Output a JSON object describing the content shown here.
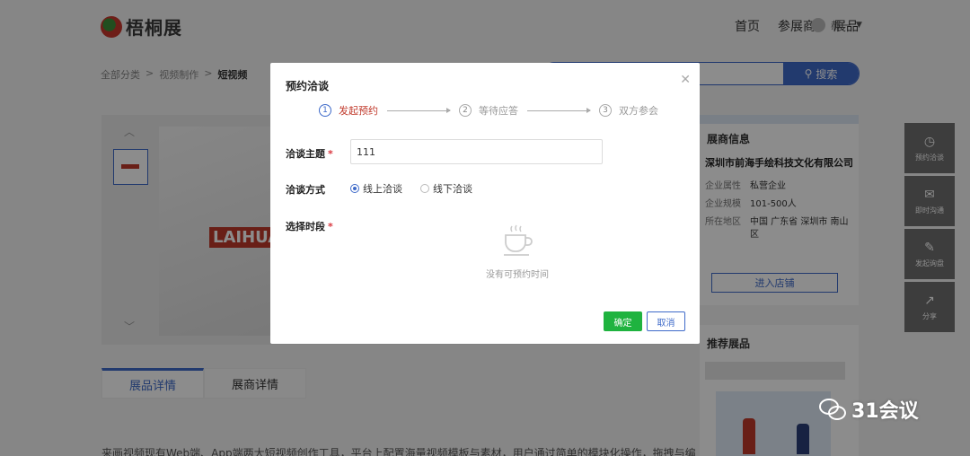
{
  "header": {
    "logo_text": "梧桐展",
    "nav": [
      "首页",
      "参展商",
      "展品"
    ],
    "user_name": "郝一"
  },
  "breadcrumb": {
    "items": [
      "全部分类",
      "视频制作"
    ],
    "current": "短视频",
    "separator": ">"
  },
  "search": {
    "button_label": "搜索"
  },
  "gallery": {
    "brand_text": "LAIHUA"
  },
  "detail_tabs": [
    "展品详情",
    "展商详情"
  ],
  "description": "来画视频现有Web端、App端两大短视频创作工具，平台上配置海量视频模板与素材，用户通过简单的模块化操作，拖拽与编",
  "exhibitor": {
    "title": "展商信息",
    "company": "深圳市前海手绘科技文化有限公司",
    "fields": [
      {
        "key": "企业属性",
        "value": "私营企业"
      },
      {
        "key": "企业规模",
        "value": "101-500人"
      },
      {
        "key": "所在地区",
        "value": "中国 广东省 深圳市 南山区"
      }
    ],
    "enter_button": "进入店铺"
  },
  "recommend": {
    "title": "推荐展品"
  },
  "side_tools": [
    {
      "icon": "clock-icon",
      "label": "预约洽谈"
    },
    {
      "icon": "chat-icon",
      "label": "即时沟通"
    },
    {
      "icon": "inquiry-icon",
      "label": "发起询盘"
    },
    {
      "icon": "share-icon",
      "label": "分享"
    }
  ],
  "watermark": "31会议",
  "modal": {
    "title": "预约洽谈",
    "steps": [
      {
        "num": "1",
        "label": "发起预约"
      },
      {
        "num": "2",
        "label": "等待应答"
      },
      {
        "num": "3",
        "label": "双方参会"
      }
    ],
    "topic_label": "洽谈主题",
    "topic_value": "111",
    "method_label": "洽谈方式",
    "methods": [
      "线上洽谈",
      "线下洽谈"
    ],
    "time_label": "选择时段",
    "empty_text": "没有可预约时间",
    "confirm": "确定",
    "cancel": "取消"
  },
  "colors": {
    "primary": "#3e6ac9",
    "confirm": "#1fb33f",
    "required": "#d9363e"
  }
}
